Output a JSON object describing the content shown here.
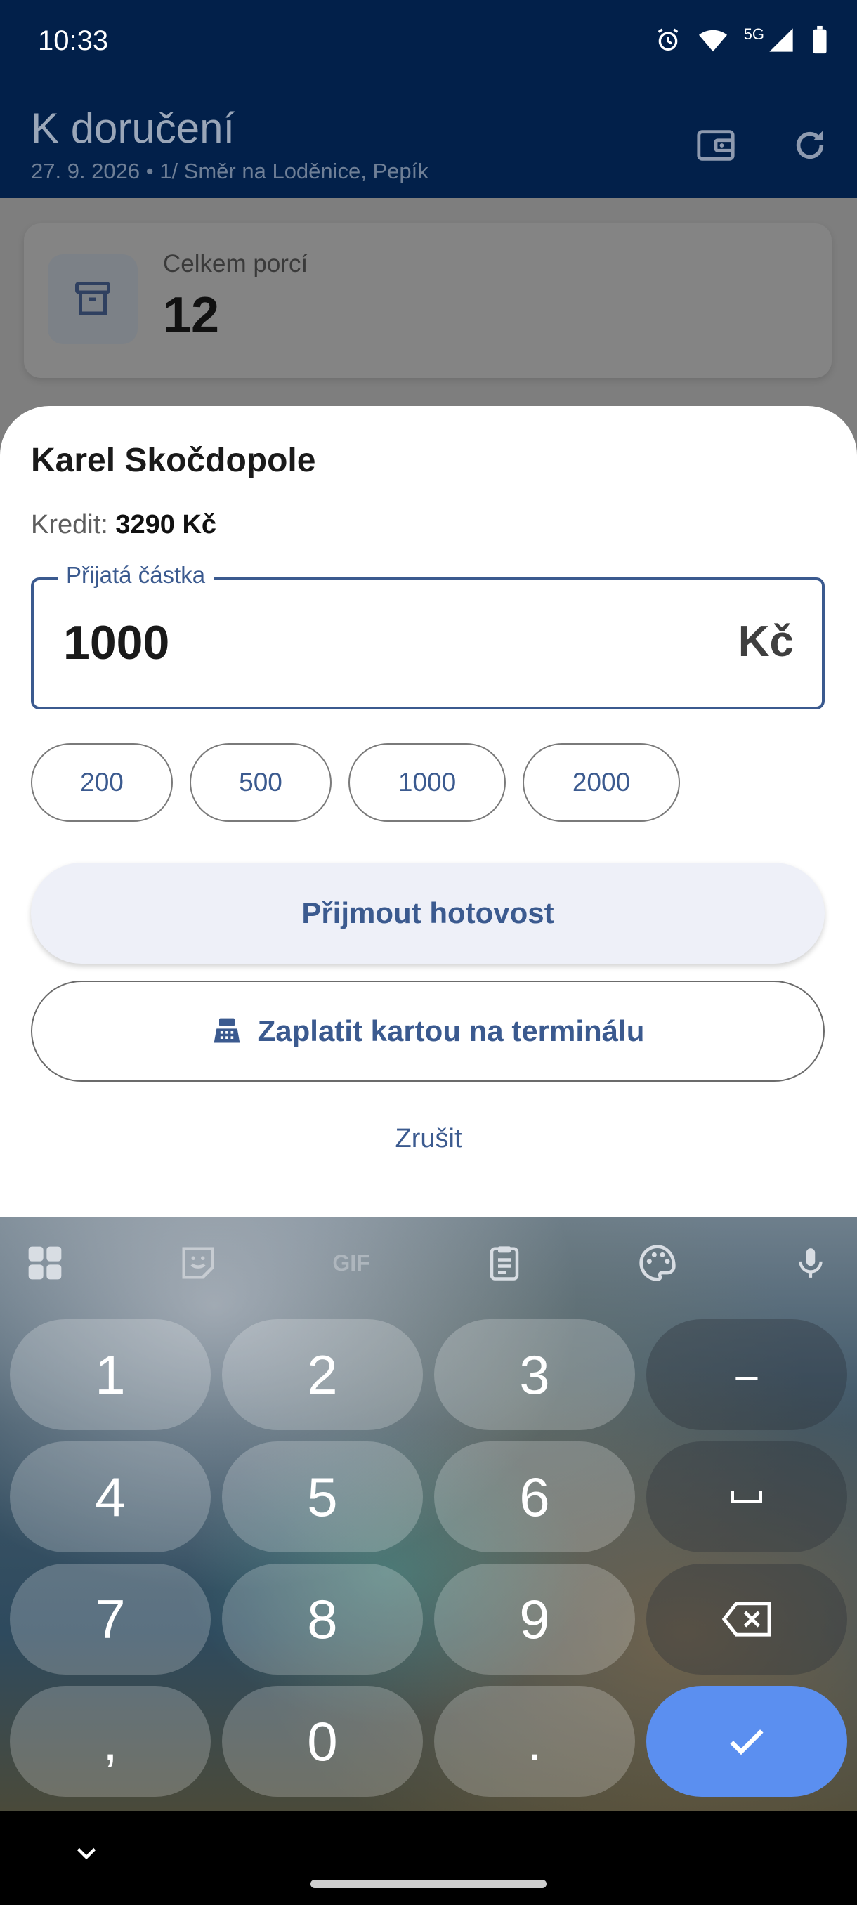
{
  "status_bar": {
    "time": "10:33",
    "network": "5G"
  },
  "app_bar": {
    "title": "K doručení",
    "subtitle": "27. 9. 2026 • 1/ Směr na Loděnice, Pepík",
    "icons": [
      "wallet-icon",
      "refresh-icon"
    ]
  },
  "summary": {
    "label": "Celkem porcí",
    "value": "12",
    "icon": "archive-icon"
  },
  "sheet": {
    "customer_name": "Karel Skočdopole",
    "credit_label": "Kredit:",
    "credit_value": "3290 Kč",
    "amount_field": {
      "label": "Přijatá částka",
      "value": "1000",
      "currency": "Kč"
    },
    "quick_amounts": [
      "200",
      "500",
      "1000",
      "2000"
    ],
    "accept_cash_label": "Přijmout hotovost",
    "pay_card_label": "Zaplatit kartou na terminálu",
    "cancel_label": "Zrušit"
  },
  "keyboard": {
    "toolbar": [
      "apps-grid-icon",
      "sticker-icon",
      "GIF",
      "clipboard-icon",
      "palette-icon",
      "mic-icon"
    ],
    "keys": [
      [
        "1",
        "2",
        "3",
        "–"
      ],
      [
        "4",
        "5",
        "6",
        "␣"
      ],
      [
        "7",
        "8",
        "9",
        "⌫"
      ],
      [
        ",",
        "0",
        ".",
        "✓"
      ]
    ],
    "accent_color": "#5b8ff0"
  },
  "colors": {
    "primary": "#3b5a8f",
    "app_bar": "#02204a"
  }
}
